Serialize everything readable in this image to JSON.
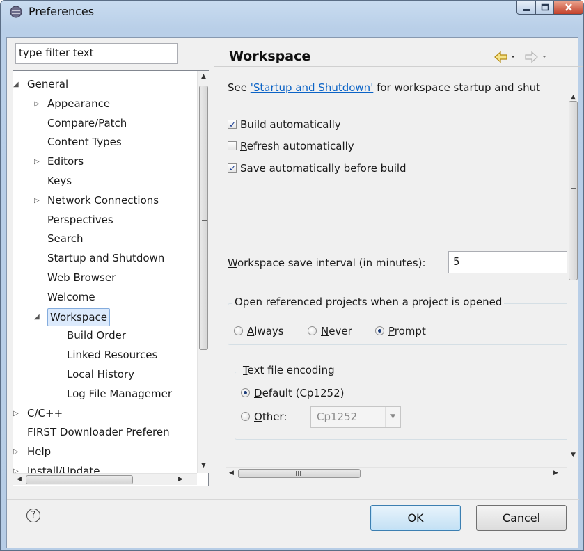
{
  "window": {
    "title": "Preferences"
  },
  "left": {
    "filter_placeholder": "type filter text",
    "tree": [
      {
        "label": "General",
        "level": 0,
        "twisty": "expanded"
      },
      {
        "label": "Appearance",
        "level": 1,
        "twisty": "collapsed"
      },
      {
        "label": "Compare/Patch",
        "level": 1,
        "twisty": "none"
      },
      {
        "label": "Content Types",
        "level": 1,
        "twisty": "none"
      },
      {
        "label": "Editors",
        "level": 1,
        "twisty": "collapsed"
      },
      {
        "label": "Keys",
        "level": 1,
        "twisty": "none"
      },
      {
        "label": "Network Connections",
        "level": 1,
        "twisty": "collapsed"
      },
      {
        "label": "Perspectives",
        "level": 1,
        "twisty": "none"
      },
      {
        "label": "Search",
        "level": 1,
        "twisty": "none"
      },
      {
        "label": "Startup and Shutdown",
        "level": 1,
        "twisty": "none"
      },
      {
        "label": "Web Browser",
        "level": 1,
        "twisty": "none"
      },
      {
        "label": "Welcome",
        "level": 1,
        "twisty": "none"
      },
      {
        "label": "Workspace",
        "level": 1,
        "twisty": "expanded",
        "selected": true
      },
      {
        "label": "Build Order",
        "level": 2,
        "twisty": "none"
      },
      {
        "label": "Linked Resources",
        "level": 2,
        "twisty": "none"
      },
      {
        "label": "Local History",
        "level": 2,
        "twisty": "none"
      },
      {
        "label": "Log File Managemer",
        "level": 2,
        "twisty": "none"
      },
      {
        "label": "C/C++",
        "level": 0,
        "twisty": "collapsed"
      },
      {
        "label": "FIRST Downloader Preferen",
        "level": 0,
        "twisty": "none"
      },
      {
        "label": "Help",
        "level": 0,
        "twisty": "collapsed"
      },
      {
        "label": "Install/Update",
        "level": 0,
        "twisty": "collapsed"
      }
    ]
  },
  "right": {
    "page_title": "Workspace",
    "intro_prefix": "See ",
    "intro_link": "'Startup and Shutdown'",
    "intro_suffix": " for workspace startup and shut",
    "build_auto": {
      "pre": "",
      "mnemonic": "B",
      "post": "uild automatically",
      "checked": true
    },
    "refresh_auto": {
      "pre": "",
      "mnemonic": "R",
      "post": "efresh automatically",
      "checked": false
    },
    "save_auto": {
      "pre": "Save auto",
      "mnemonic": "m",
      "post": "atically before build",
      "checked": true
    },
    "interval_label_mnemonic": "W",
    "interval_label_rest": "orkspace save interval (in minutes):",
    "interval_value": "5",
    "open_group_label": "Open referenced projects when a project is opened",
    "open_options": [
      {
        "mnemonic": "A",
        "rest": "lways",
        "selected": false
      },
      {
        "mnemonic": "N",
        "rest": "ever",
        "selected": false
      },
      {
        "mnemonic": "P",
        "rest": "rompt",
        "selected": true
      }
    ],
    "encoding_group_mnemonic": "T",
    "encoding_group_rest": "ext file encoding",
    "encoding_default": {
      "mnemonic": "D",
      "rest": "efault (Cp1252)",
      "selected": true
    },
    "encoding_other": {
      "mnemonic": "O",
      "rest": "ther:",
      "selected": false
    },
    "encoding_other_value": "Cp1252"
  },
  "buttons": {
    "ok": "OK",
    "cancel": "Cancel"
  },
  "icons": {
    "help": "?",
    "tree_scroll_grip": "≡",
    "hscroll_grip": "III"
  }
}
